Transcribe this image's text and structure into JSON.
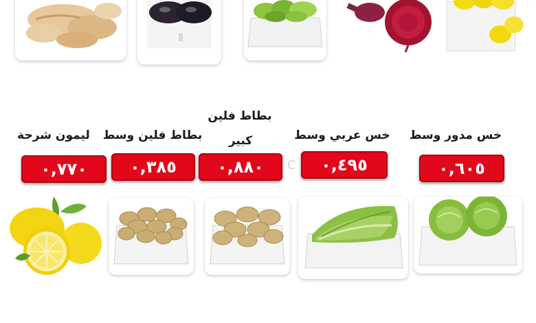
{
  "top_row": [
    {
      "id": "ginger",
      "icon": "ginger-image"
    },
    {
      "id": "eggplant",
      "icon": "eggplant-image"
    },
    {
      "id": "green-vegetable-box",
      "icon": "vegetable-box-image"
    },
    {
      "id": "beetroot",
      "icon": "beetroot-image"
    },
    {
      "id": "lemon-box",
      "icon": "lemon-box-image"
    }
  ],
  "products": [
    {
      "name": "ليمون شرحة",
      "price": "٠,٧٧٠",
      "icon": "lemon-image"
    },
    {
      "name": "بطاط فلين وسط",
      "price": "٠,٣٨٥",
      "icon": "potato-box-image"
    },
    {
      "name_line1": "بطاط فلين",
      "name_line2": "كبير",
      "price": "٠,٨٨٠",
      "icon": "potato-box-image"
    },
    {
      "name": "خس عربي وسط",
      "price": "٠,٤٩٥",
      "icon": "romaine-lettuce-image"
    },
    {
      "name": "خس مدور وسط",
      "price": "٠,٦٠٥",
      "icon": "iceberg-lettuce-image"
    }
  ],
  "stray_char": "C",
  "colors": {
    "price_badge": "#e2071a",
    "price_text": "#ffffff",
    "name_text": "#1a1a1a"
  }
}
